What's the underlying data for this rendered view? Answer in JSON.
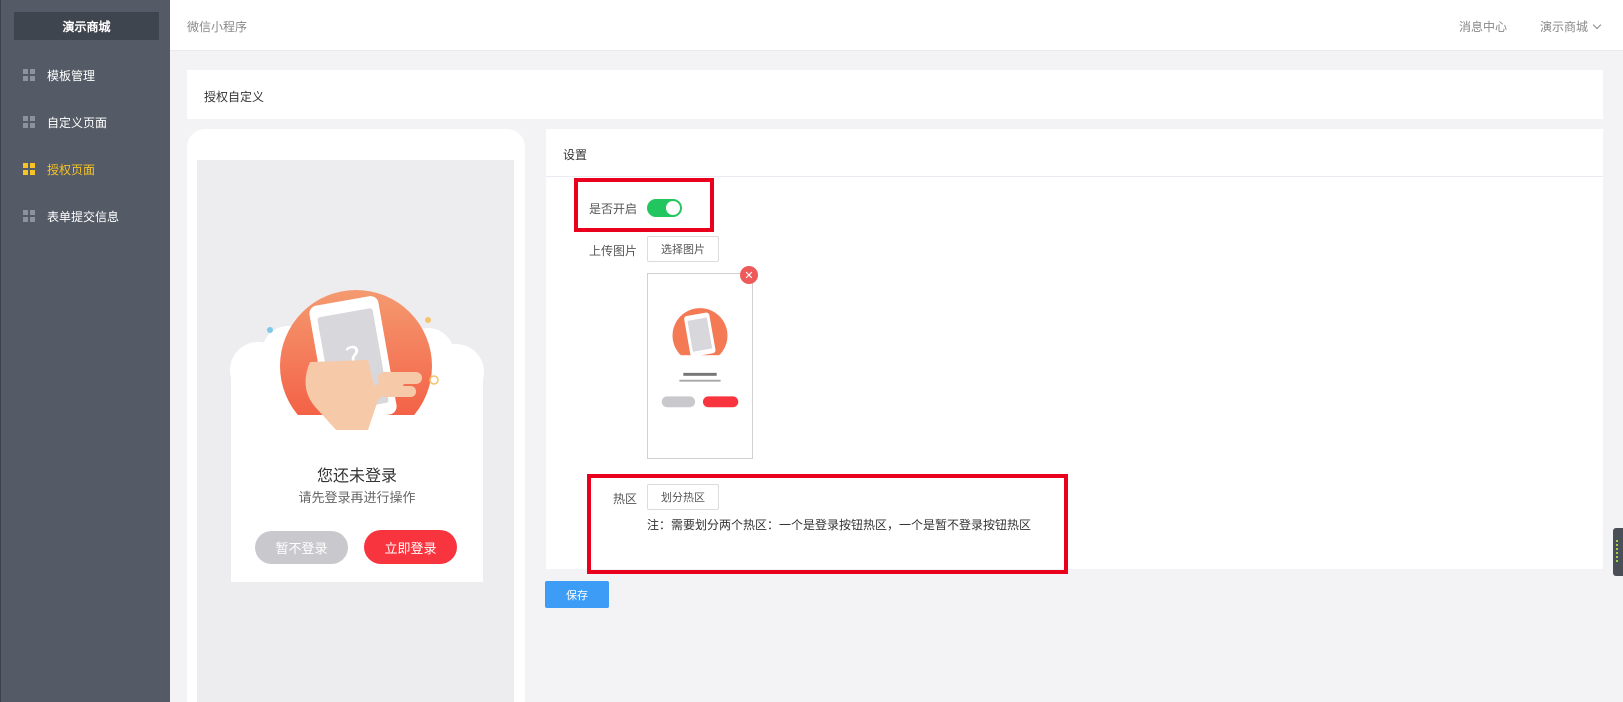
{
  "sidebar": {
    "brand": "演示商城",
    "items": [
      {
        "label": "模板管理",
        "active": false
      },
      {
        "label": "自定义页面",
        "active": false
      },
      {
        "label": "授权页面",
        "active": true
      },
      {
        "label": "表单提交信息",
        "active": false
      }
    ]
  },
  "header": {
    "breadcrumb": "微信小程序",
    "message_center": "消息中心",
    "user": "演示商城"
  },
  "page_title": "授权自定义",
  "preview": {
    "title": "您还未登录",
    "subtitle": "请先登录再进行操作",
    "skip_label": "暂不登录",
    "login_label": "立即登录"
  },
  "settings": {
    "title": "设置",
    "enable_label": "是否开启",
    "enabled": true,
    "upload_label": "上传图片",
    "choose_image_label": "选择图片",
    "hotspot_label": "热区",
    "divide_hotspot_label": "划分热区",
    "note": "注：需要划分两个热区：一个是登录按钮热区，一个是暂不登录按钮热区",
    "remove_icon": "close-icon"
  },
  "save_label": "保存",
  "colors": {
    "sidebar_bg": "#545b66",
    "active": "#f7c325",
    "toggle_on": "#22c55e",
    "login_red": "#f8343f",
    "save_blue": "#3d9cf6",
    "highlight_red": "#e8001c"
  }
}
